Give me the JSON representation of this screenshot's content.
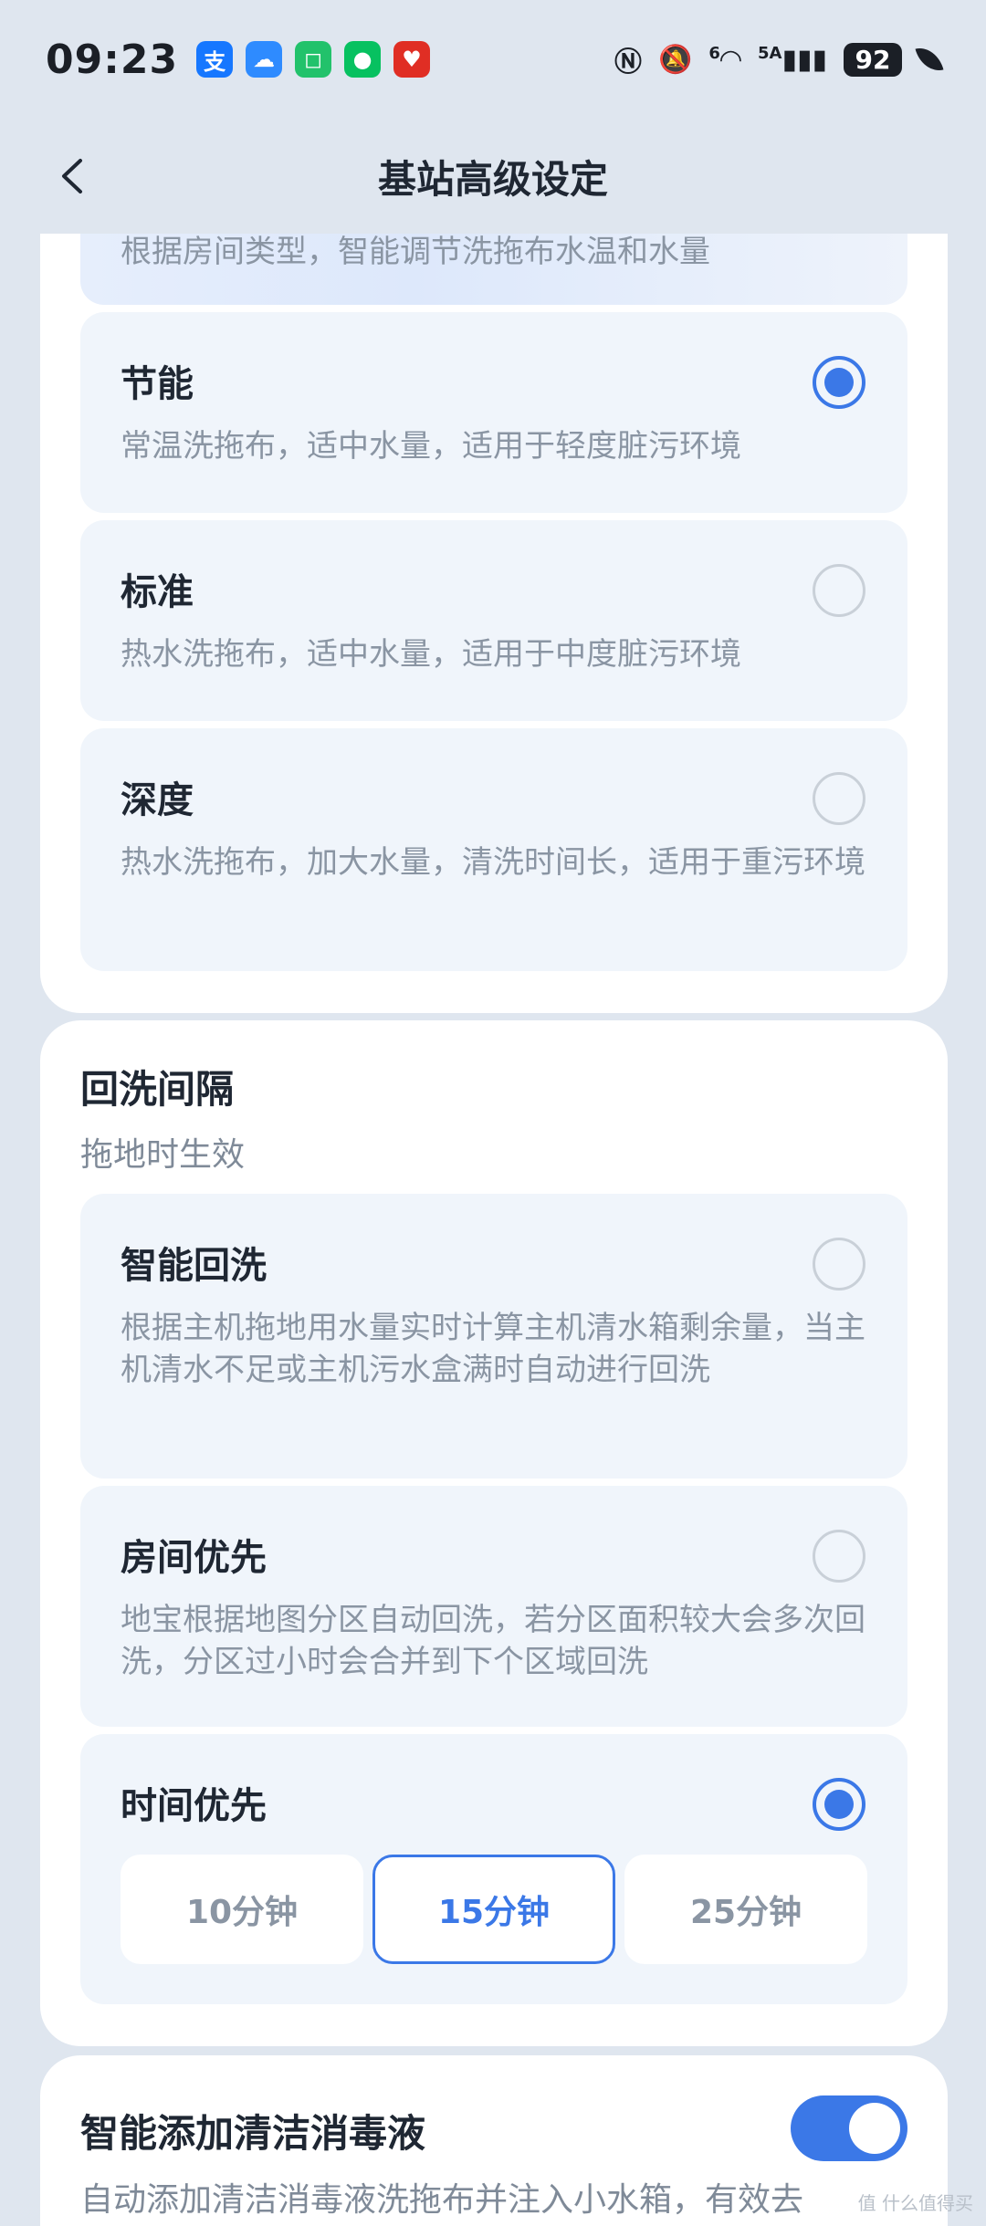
{
  "status_bar": {
    "time": "09:23",
    "apps": [
      {
        "icon": "alipay-icon",
        "glyph": "支",
        "color": "#1677ff"
      },
      {
        "icon": "weather-icon",
        "glyph": "☁",
        "color": "#2e8bff"
      },
      {
        "icon": "mijia-icon",
        "glyph": "◻",
        "color": "#22c26b"
      },
      {
        "icon": "wechat-icon",
        "glyph": "●",
        "color": "#07c160"
      },
      {
        "icon": "pinduoduo-icon",
        "glyph": "♥",
        "color": "#e02e24"
      }
    ],
    "signal": "6",
    "network": "5A",
    "battery": "92"
  },
  "header": {
    "title": "基站高级设定"
  },
  "clean_mode": {
    "cut_desc": "根据房间类型，智能调节洗拖布水温和水量",
    "options": [
      {
        "title": "节能",
        "desc": "常温洗拖布，适中水量，适用于轻度脏污环境",
        "selected": true
      },
      {
        "title": "标准",
        "desc": "热水洗拖布，适中水量，适用于中度脏污环境",
        "selected": false
      },
      {
        "title": "深度",
        "desc": "热水洗拖布，加大水量，清洗时间长，适用于重污环境",
        "selected": false
      }
    ]
  },
  "rewash": {
    "title": "回洗间隔",
    "subtitle": "拖地时生效",
    "options": [
      {
        "title": "智能回洗",
        "desc": "根据主机拖地用水量实时计算主机清水箱剩余量，当主机清水不足或主机污水盒满时自动进行回洗",
        "selected": false
      },
      {
        "title": "房间优先",
        "desc": "地宝根据地图分区自动回洗，若分区面积较大会多次回洗，分区过小时会合并到下个区域回洗",
        "selected": false
      },
      {
        "title": "时间优先",
        "selected": true
      }
    ],
    "intervals": [
      "10分钟",
      "15分钟",
      "25分钟"
    ],
    "selected_interval": "15分钟"
  },
  "disinfectant": {
    "title": "智能添加清洁消毒液",
    "desc": "自动添加清洁消毒液洗拖布并注入小水箱，有效去",
    "enabled": true
  },
  "watermark": "值 什么值得买"
}
